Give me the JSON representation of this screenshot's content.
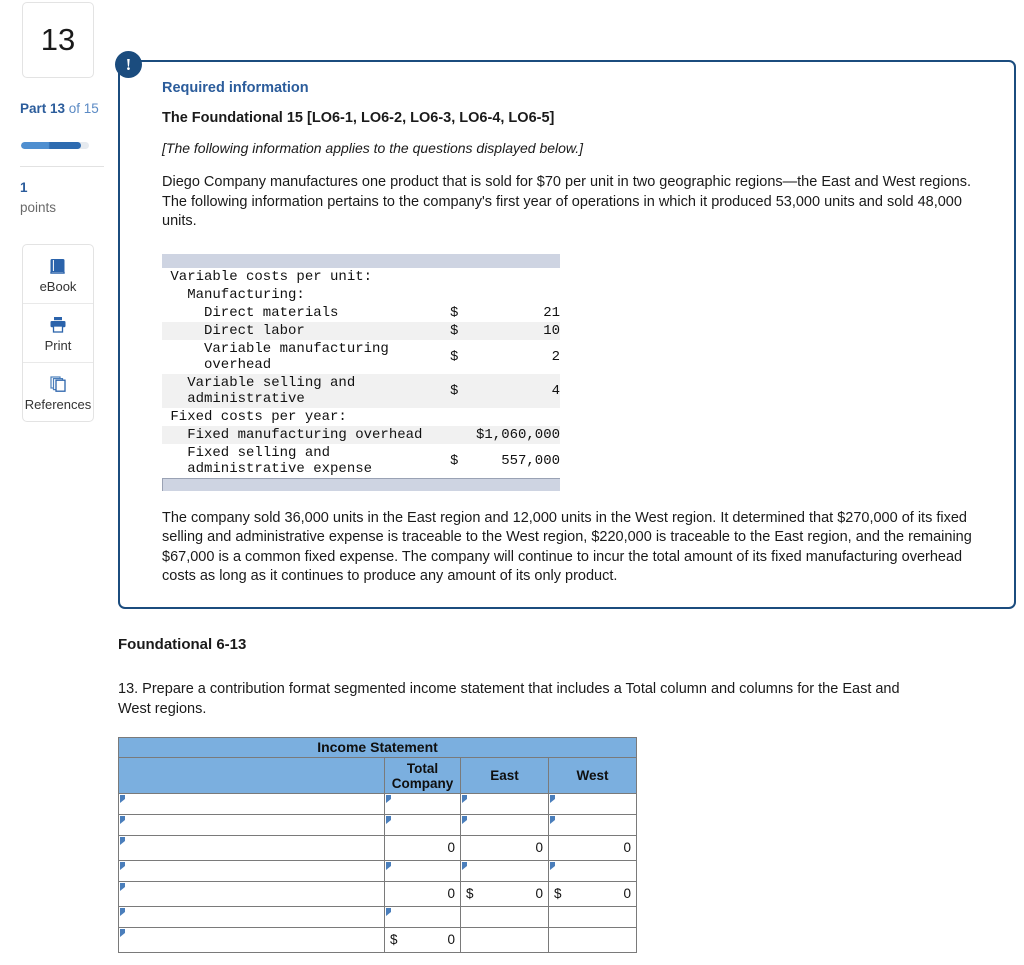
{
  "left_rail": {
    "question_number": "13",
    "part_prefix": "Part 13",
    "part_suffix": " of 15",
    "points_value": "1",
    "points_label": "points",
    "tools": [
      {
        "label": "eBook",
        "icon": "book-icon"
      },
      {
        "label": "Print",
        "icon": "printer-icon"
      },
      {
        "label": "References",
        "icon": "copy-pages-icon"
      }
    ]
  },
  "callout": {
    "badge": "!",
    "required_information": "Required information",
    "foundational_heading": "The Foundational 15 [LO6-1, LO6-2, LO6-3, LO6-4, LO6-5]",
    "applies_note": "[The following information applies to the questions displayed below.]",
    "intro_paragraph": "Diego Company manufactures one product that is sold for $70 per unit in two geographic regions—the East and West regions. The following information pertains to the company's first year of operations in which it produced 53,000 units and sold 48,000 units.",
    "closing_paragraph": "The company sold 36,000 units in the East region and 12,000 units in the West region. It determined that $270,000 of its fixed selling and administrative expense is traceable to the West region, $220,000 is traceable to the East region, and the remaining $67,000 is a common fixed expense. The company will continue to incur the total amount of its fixed manufacturing overhead costs as long as it continues to produce any amount of its only product."
  },
  "cost_table": {
    "rows": [
      {
        "label": "Variable costs per unit:",
        "symbol": "",
        "value": "",
        "indent": 0,
        "shade": false
      },
      {
        "label": "Manufacturing:",
        "symbol": "",
        "value": "",
        "indent": 1,
        "shade": false
      },
      {
        "label": "Direct materials",
        "symbol": "$",
        "value": "21",
        "indent": 2,
        "shade": false
      },
      {
        "label": "Direct labor",
        "symbol": "$",
        "value": "10",
        "indent": 2,
        "shade": true
      },
      {
        "label": "Variable manufacturing\noverhead",
        "symbol": "$",
        "value": "2",
        "indent": 2,
        "shade": false
      },
      {
        "label": "Variable selling and\nadministrative",
        "symbol": "$",
        "value": "4",
        "indent": 1,
        "shade": true
      },
      {
        "label": "Fixed costs per year:",
        "symbol": "",
        "value": "",
        "indent": 0,
        "shade": false
      },
      {
        "label": "Fixed manufacturing overhead",
        "symbol": "",
        "value": "$1,060,000",
        "indent": 1,
        "shade": true,
        "wide": true
      },
      {
        "label": "Fixed selling and\nadministrative expense",
        "symbol": "$",
        "value": "557,000",
        "indent": 1,
        "shade": false
      }
    ]
  },
  "question": {
    "heading": "Foundational 6-13",
    "text": "13. Prepare a contribution format segmented income statement that includes a Total column and columns for the East and West regions."
  },
  "answer_table": {
    "title": "Income Statement",
    "columns": [
      "",
      "Total Company",
      "East",
      "West"
    ],
    "column_total_line1": "Total",
    "column_total_line2": "Company",
    "column_east": "East",
    "column_west": "West",
    "rows": [
      {
        "desc": "",
        "total": {
          "sym": "",
          "val": "",
          "marker": true
        },
        "east": {
          "sym": "",
          "val": "",
          "marker": true
        },
        "west": {
          "sym": "",
          "val": "",
          "marker": true
        },
        "marker": true,
        "topline": false
      },
      {
        "desc": "",
        "total": {
          "sym": "",
          "val": "",
          "marker": true
        },
        "east": {
          "sym": "",
          "val": "",
          "marker": true
        },
        "west": {
          "sym": "",
          "val": "",
          "marker": true
        },
        "marker": true,
        "topline": false
      },
      {
        "desc": "",
        "total": {
          "sym": "",
          "val": "0",
          "marker": false
        },
        "east": {
          "sym": "",
          "val": "0",
          "marker": false
        },
        "west": {
          "sym": "",
          "val": "0",
          "marker": false
        },
        "marker": true,
        "topline": true
      },
      {
        "desc": "",
        "total": {
          "sym": "",
          "val": "",
          "marker": true
        },
        "east": {
          "sym": "",
          "val": "",
          "marker": true
        },
        "west": {
          "sym": "",
          "val": "",
          "marker": true
        },
        "marker": true,
        "topline": false
      },
      {
        "desc": "",
        "total": {
          "sym": "",
          "val": "0",
          "marker": false
        },
        "east": {
          "sym": "$",
          "val": "0",
          "marker": false
        },
        "west": {
          "sym": "$",
          "val": "0",
          "marker": false
        },
        "marker": true,
        "topline": true
      },
      {
        "desc": "",
        "total": {
          "sym": "",
          "val": "",
          "marker": true
        },
        "east": {
          "sym": "",
          "val": "",
          "marker": false
        },
        "west": {
          "sym": "",
          "val": "",
          "marker": false
        },
        "marker": true,
        "topline": false
      },
      {
        "desc": "",
        "total": {
          "sym": "$",
          "val": "0",
          "marker": false
        },
        "east": {
          "sym": "",
          "val": "",
          "marker": false
        },
        "west": {
          "sym": "",
          "val": "",
          "marker": false
        },
        "marker": true,
        "topline": true
      }
    ]
  },
  "colors": {
    "accent_blue": "#2b5c9b",
    "callout_border": "#1b4c7e",
    "table_header_blue": "#7bafdf",
    "mono_cap_gray": "#ced4e2",
    "marker_blue": "#4a7ebb"
  }
}
